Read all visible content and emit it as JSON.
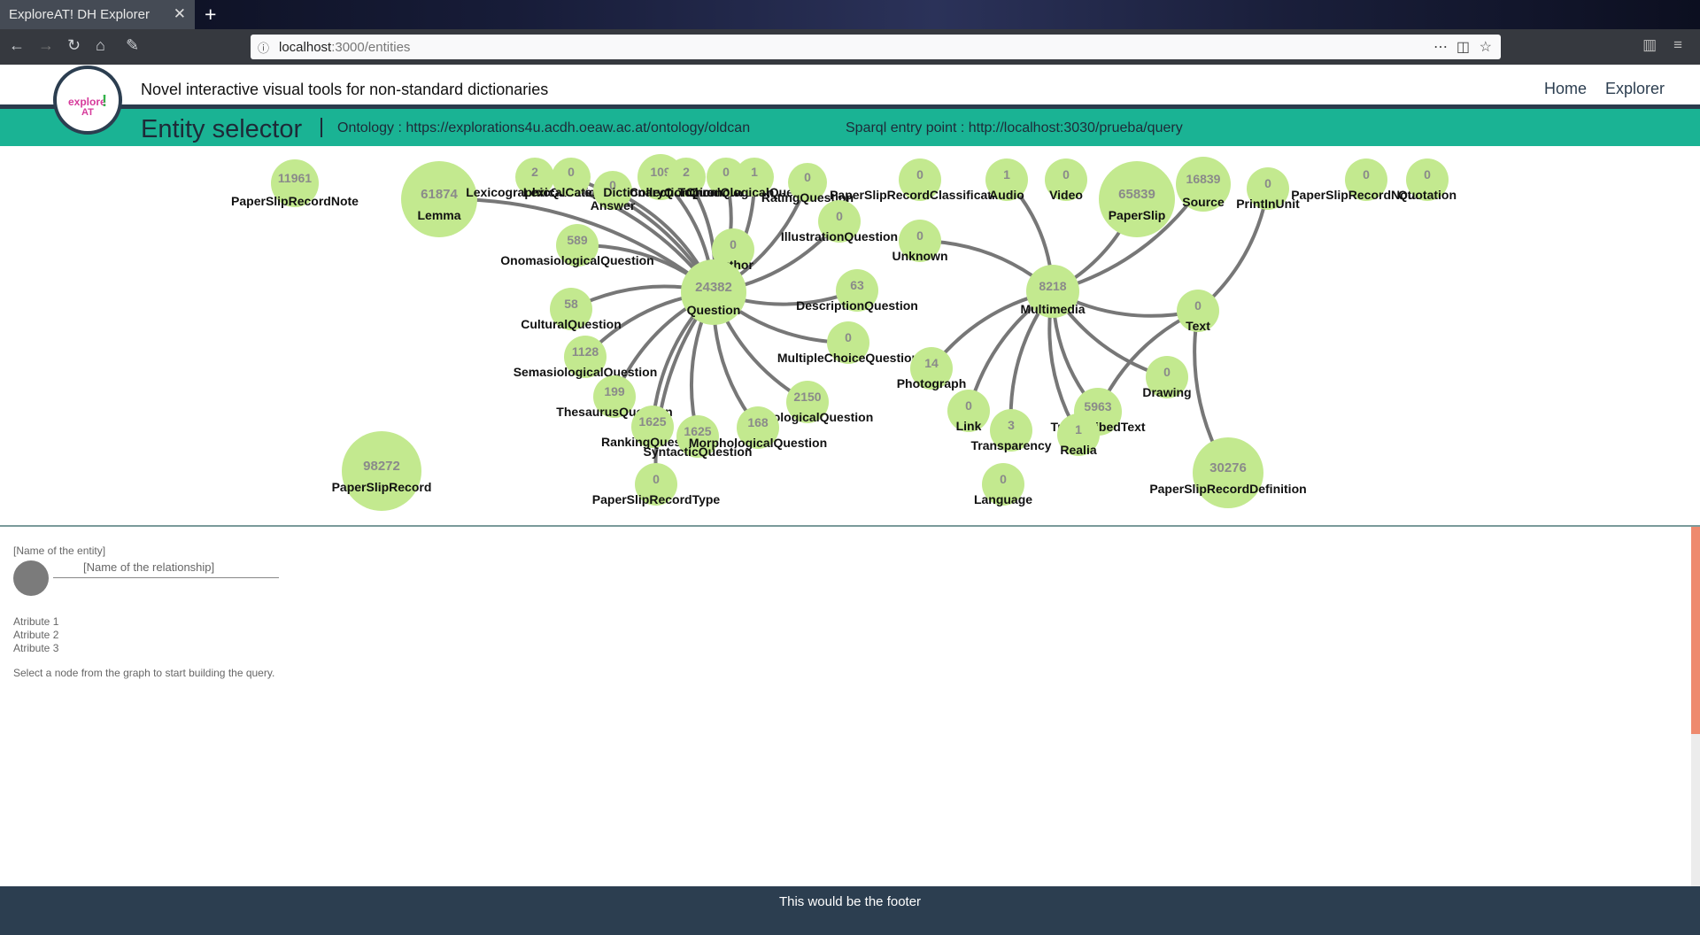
{
  "browser": {
    "tab_title": "ExploreAT! DH Explorer",
    "url_host": "localhost",
    "url_path": ":3000/entities"
  },
  "app": {
    "logo_top": "explore",
    "logo_bottom": "AT",
    "logo_mark": "!",
    "tagline": "Novel interactive visual tools for non-standard dictionaries",
    "nav_home": "Home",
    "nav_explorer": "Explorer",
    "page_title": "Entity selector",
    "ontology": "Ontology : https://explorations4u.acdh.oeaw.ac.at/ontology/oldcan",
    "sparql": "Sparql entry point : http://localhost:3030/prueba/query"
  },
  "graph": {
    "node_color": "#c3e98f",
    "edge_color": "#777777",
    "nodes": [
      {
        "id": "PaperSlipRecordNote",
        "count": "11961"
      },
      {
        "id": "Lemma",
        "count": "61874"
      },
      {
        "id": "LexicographicQuestion",
        "count": "2"
      },
      {
        "id": "LexicalCategory",
        "count": "0"
      },
      {
        "id": "Answer",
        "count": "0"
      },
      {
        "id": "DictionaryQuestion",
        "count": "109"
      },
      {
        "id": "CollectionQuestion",
        "count": "2"
      },
      {
        "id": "TopicalQuestion",
        "count": "0"
      },
      {
        "id": "ChronologicalQuestion",
        "count": "1"
      },
      {
        "id": "RatingQuestion",
        "count": "0"
      },
      {
        "id": "PaperSlipRecordClassification",
        "count": "0"
      },
      {
        "id": "Audio",
        "count": "1"
      },
      {
        "id": "Video",
        "count": "0"
      },
      {
        "id": "PaperSlip",
        "count": "65839"
      },
      {
        "id": "Source",
        "count": "16839"
      },
      {
        "id": "PrintInUnit",
        "count": "0"
      },
      {
        "id": "PaperSlipRecordNotation",
        "count": "0"
      },
      {
        "id": "Quotation",
        "count": "0"
      },
      {
        "id": "OnomasiologicalQuestion",
        "count": "589"
      },
      {
        "id": "Author",
        "count": "0"
      },
      {
        "id": "IllustrationQuestion",
        "count": "0"
      },
      {
        "id": "Unknown",
        "count": "0"
      },
      {
        "id": "Question",
        "count": "24382"
      },
      {
        "id": "Multimedia",
        "count": "8218"
      },
      {
        "id": "CulturalQuestion",
        "count": "58"
      },
      {
        "id": "DescriptionQuestion",
        "count": "63"
      },
      {
        "id": "Text",
        "count": "0"
      },
      {
        "id": "SemasiologicalQuestion",
        "count": "1128"
      },
      {
        "id": "MultipleChoiceQuestion",
        "count": "0"
      },
      {
        "id": "Photograph",
        "count": "14"
      },
      {
        "id": "Drawing",
        "count": "0"
      },
      {
        "id": "ThesaurusQuestion",
        "count": "199"
      },
      {
        "id": "PhonologicalQuestion",
        "count": "2150"
      },
      {
        "id": "Link",
        "count": "0"
      },
      {
        "id": "Transparency",
        "count": "3"
      },
      {
        "id": "TranscribedText",
        "count": "5963"
      },
      {
        "id": "Realia",
        "count": "1"
      },
      {
        "id": "RankingQuestion",
        "count": "1625"
      },
      {
        "id": "SyntacticQuestion",
        "count": "1625"
      },
      {
        "id": "MorphologicalQuestion",
        "count": "168"
      },
      {
        "id": "PaperSlipRecord",
        "count": "98272"
      },
      {
        "id": "PaperSlipRecordType",
        "count": "0"
      },
      {
        "id": "Language",
        "count": "0"
      },
      {
        "id": "PaperSlipRecordDefinition",
        "count": "30276"
      }
    ],
    "edges": [
      [
        "Question",
        "OnomasiologicalQuestion"
      ],
      [
        "Question",
        "CulturalQuestion"
      ],
      [
        "Question",
        "SemasiologicalQuestion"
      ],
      [
        "Question",
        "ThesaurusQuestion"
      ],
      [
        "Question",
        "RankingQuestion"
      ],
      [
        "Question",
        "SyntacticQuestion"
      ],
      [
        "Question",
        "MorphologicalQuestion"
      ],
      [
        "Question",
        "PhonologicalQuestion"
      ],
      [
        "Question",
        "MultipleChoiceQuestion"
      ],
      [
        "Question",
        "DescriptionQuestion"
      ],
      [
        "Question",
        "IllustrationQuestion"
      ],
      [
        "Question",
        "RatingQuestion"
      ],
      [
        "Question",
        "ChronologicalQuestion"
      ],
      [
        "Question",
        "TopicalQuestion"
      ],
      [
        "Question",
        "CollectionQuestion"
      ],
      [
        "Question",
        "DictionaryQuestion"
      ],
      [
        "Question",
        "Answer"
      ],
      [
        "Question",
        "LexicalCategory"
      ],
      [
        "Question",
        "LexicographicQuestion"
      ],
      [
        "Question",
        "Author"
      ],
      [
        "Question",
        "Lemma"
      ],
      [
        "Question",
        "PaperSlipRecordType"
      ],
      [
        "Multimedia",
        "Unknown"
      ],
      [
        "Multimedia",
        "Audio"
      ],
      [
        "Multimedia",
        "PaperSlip"
      ],
      [
        "Multimedia",
        "Source"
      ],
      [
        "Multimedia",
        "Text"
      ],
      [
        "Multimedia",
        "Drawing"
      ],
      [
        "Multimedia",
        "Photograph"
      ],
      [
        "Multimedia",
        "Link"
      ],
      [
        "Multimedia",
        "Transparency"
      ],
      [
        "Multimedia",
        "Realia"
      ],
      [
        "Multimedia",
        "TranscribedText"
      ],
      [
        "Text",
        "PrintInUnit"
      ],
      [
        "Text",
        "TranscribedText"
      ],
      [
        "Text",
        "PaperSlipRecordDefinition"
      ]
    ]
  },
  "query": {
    "entity_placeholder": "[Name of the entity]",
    "relationship_placeholder": "[Name of the relationship]",
    "attributes": [
      "Atribute 1",
      "Atribute 2",
      "Atribute 3"
    ],
    "hint": "Select a node from the graph to start building the query."
  },
  "footer": "This would be the footer"
}
